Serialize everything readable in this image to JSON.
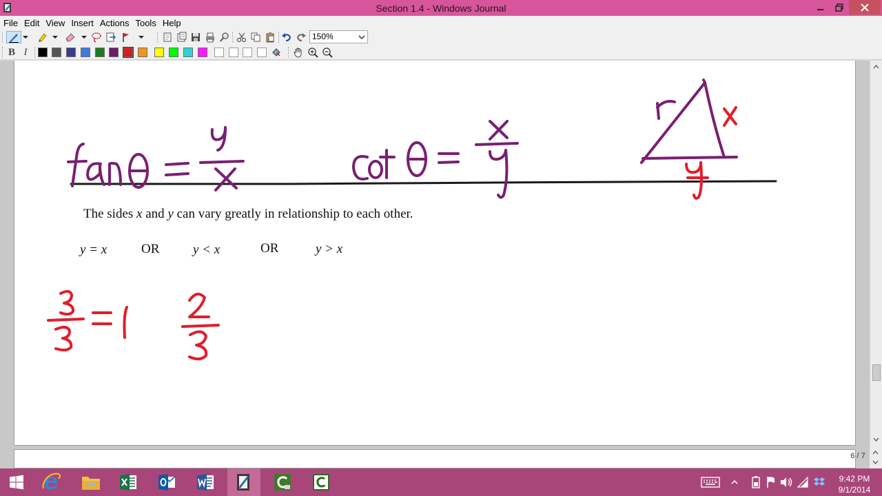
{
  "window": {
    "title": "Section 1.4 - Windows Journal"
  },
  "menu": [
    "File",
    "Edit",
    "View",
    "Insert",
    "Actions",
    "Tools",
    "Help"
  ],
  "toolbar": {
    "zoom_value": "150%",
    "bold_label": "B",
    "italic_label": "I",
    "pen_colors": [
      "#000000",
      "#555555",
      "#3a3a8c",
      "#3d7dd6",
      "#1f7a1f",
      "#6a1b6a",
      "#d81b1b",
      "#f0961e",
      "#ffff00",
      "#00ff00",
      "#2fd2d2",
      "#ff19ff"
    ],
    "highlighter_colors": [
      "#ffffff",
      "#ffffff",
      "#ffffff",
      "#ffffff",
      "#ffffff"
    ]
  },
  "page": {
    "typed_sentence_pre": "The sides ",
    "typed_var_x": "x",
    "typed_and": " and ",
    "typed_var_y": "y",
    "typed_sentence_post": " can vary greatly in relationship to each other.",
    "relation_1": "y = x",
    "or_1": "OR",
    "relation_2": "y < x",
    "or_2": "OR",
    "relation_3": "y > x",
    "ink_colors": {
      "purple": "#7a1f72",
      "red": "#e01e2b",
      "black": "#1a1a1a"
    },
    "page_indicator": "6 / 7"
  },
  "taskbar": {
    "time": "9:42 PM",
    "date": "9/1/2014"
  }
}
